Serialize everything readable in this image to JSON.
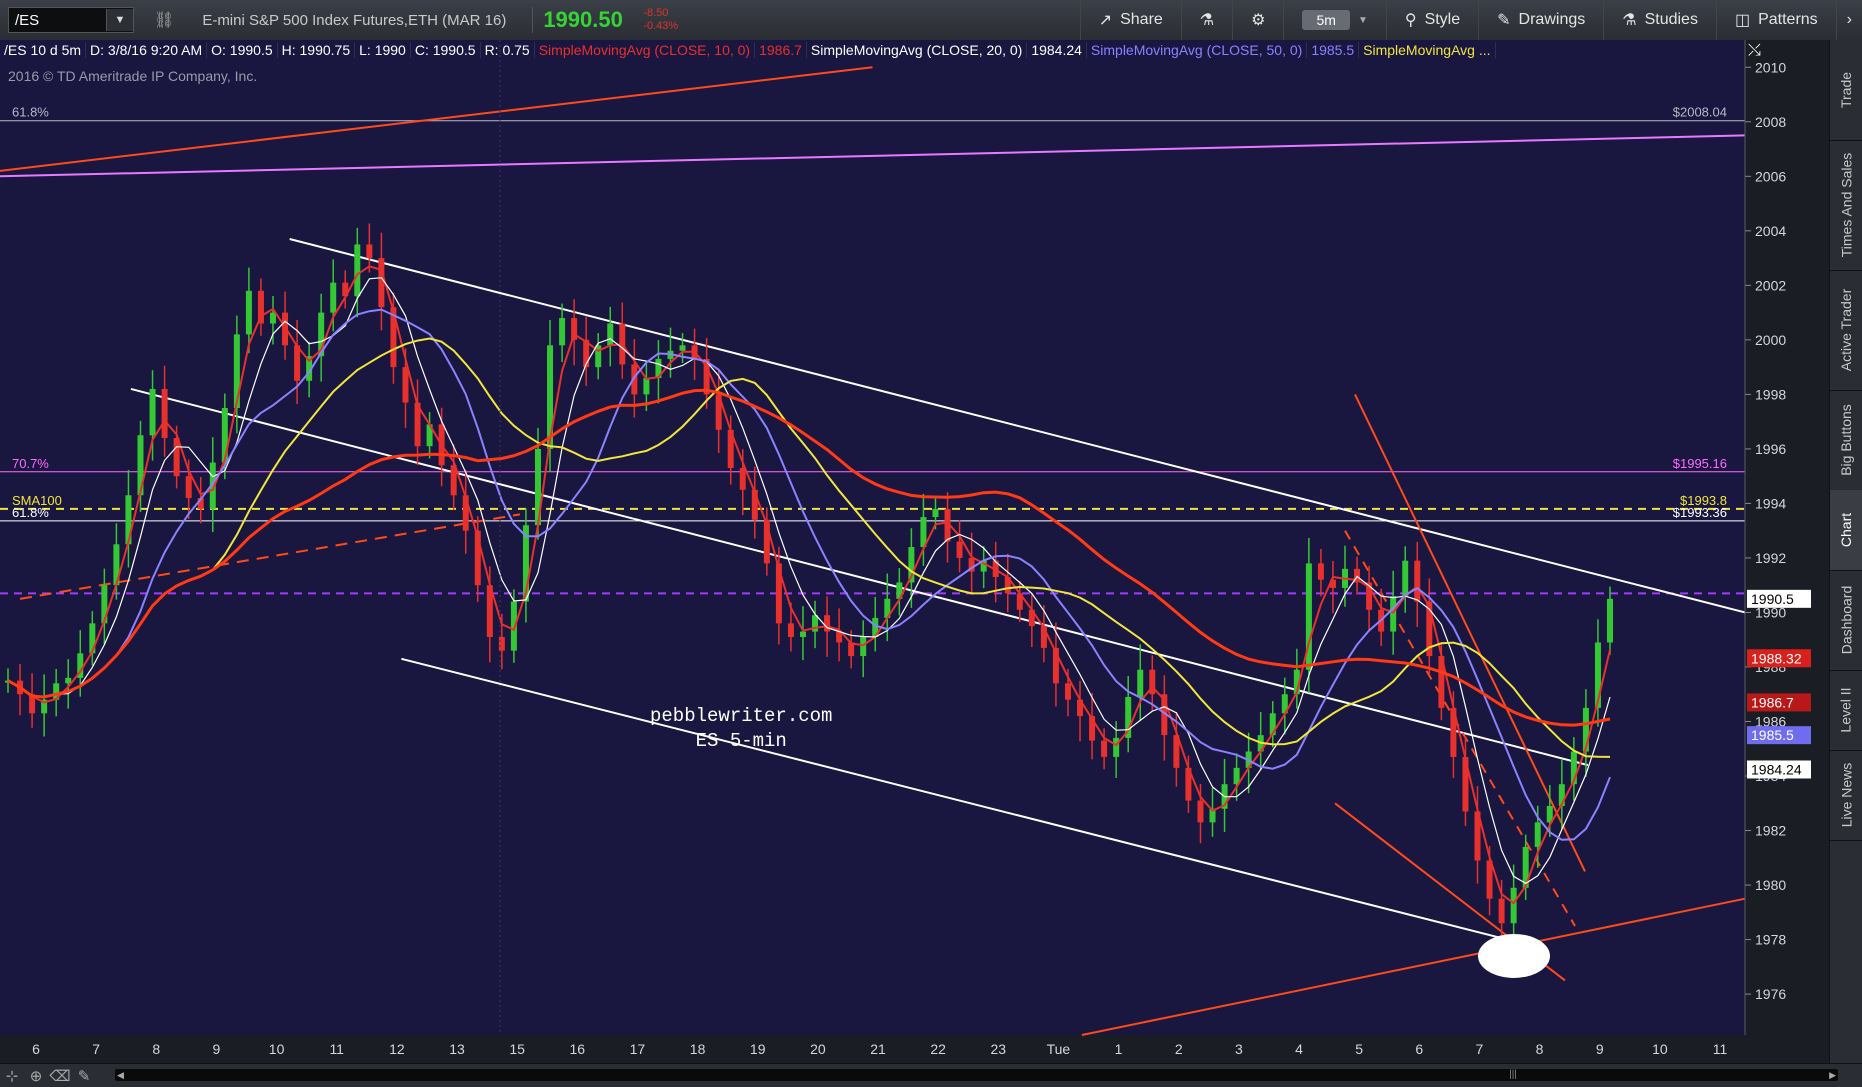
{
  "toolbar": {
    "symbol": "/ES",
    "description": "E-mini S&P 500 Index Futures,ETH (MAR 16)",
    "last_price": "1990.50",
    "change": "-8.50",
    "change_pct": "-0.43%",
    "share_label": "Share",
    "timeframe": "5m",
    "style_label": "Style",
    "drawings_label": "Drawings",
    "studies_label": "Studies",
    "patterns_label": "Patterns"
  },
  "header": {
    "cells": [
      {
        "text": "/ES 10 d 5m",
        "color": "#ffffff"
      },
      {
        "text": "D: 3/8/16 9:20 AM",
        "color": "#ffffff"
      },
      {
        "text": "O: 1990.5",
        "color": "#ffffff"
      },
      {
        "text": "H: 1990.75",
        "color": "#ffffff"
      },
      {
        "text": "L: 1990",
        "color": "#ffffff"
      },
      {
        "text": "C: 1990.5",
        "color": "#ffffff"
      },
      {
        "text": "R: 0.75",
        "color": "#ffffff"
      },
      {
        "text": "SimpleMovingAvg (CLOSE, 10, 0)",
        "color": "#e8312c"
      },
      {
        "text": "1986.7",
        "color": "#e8312c"
      },
      {
        "text": "SimpleMovingAvg (CLOSE, 20, 0)",
        "color": "#ffffff"
      },
      {
        "text": "1984.24",
        "color": "#ffffff"
      },
      {
        "text": "SimpleMovingAvg (CLOSE, 50, 0)",
        "color": "#8a83ff"
      },
      {
        "text": "1985.5",
        "color": "#8a83ff"
      },
      {
        "text": "SimpleMovingAvg ...",
        "color": "#f0e63c"
      }
    ]
  },
  "copyright": "2016 © TD Ameritrade IP Company, Inc.",
  "watermark": {
    "line1": "pebblewriter.com",
    "line2": "ES 5-min"
  },
  "side_tabs": [
    "Trade",
    "Times And Sales",
    "Active Trader",
    "Big Buttons",
    "Chart",
    "Dashboard",
    "Level II",
    "Live News"
  ],
  "active_side_tab": "Chart",
  "chart_data": {
    "type": "candlestick",
    "symbol": "/ES",
    "interval": "5m",
    "ylim": [
      1974.5,
      2011
    ],
    "y_ticks": [
      1976,
      1978,
      1980,
      1982,
      1984,
      1986,
      1988,
      1990,
      1992,
      1994,
      1996,
      1998,
      2000,
      2002,
      2004,
      2006,
      2008,
      2010
    ],
    "x_ticks": [
      "6",
      "7",
      "8",
      "9",
      "10",
      "11",
      "12",
      "13",
      "15",
      "16",
      "17",
      "18",
      "19",
      "20",
      "21",
      "22",
      "23",
      "Tue",
      "1",
      "2",
      "3",
      "4",
      "5",
      "6",
      "7",
      "8",
      "9",
      "10",
      "11"
    ],
    "price_labels": [
      {
        "text": "1990.5",
        "value": 1990.5,
        "bg": "#ffffff",
        "fg": "#000000"
      },
      {
        "text": "1988.32",
        "value": 1988.32,
        "bg": "#d8201c",
        "fg": "#ffffff"
      },
      {
        "text": "1986.7",
        "value": 1986.7,
        "bg": "#b81818",
        "fg": "#ffffff"
      },
      {
        "text": "1985.5",
        "value": 1985.5,
        "bg": "#6f6cf0",
        "fg": "#ffffff"
      },
      {
        "text": "1984.24",
        "value": 1984.24,
        "bg": "#ffffff",
        "fg": "#000000"
      }
    ],
    "levels": [
      {
        "value": 2008.04,
        "left_label": "61.8%",
        "right_label": "$2008.04",
        "color": "#b8b8c8",
        "style": "solid"
      },
      {
        "value": 1995.16,
        "left_label": "70.7%",
        "right_label": "$1995.16",
        "color": "#ff6cff",
        "style": "solid"
      },
      {
        "value": 1993.8,
        "left_label": "SMA100",
        "right_label": "$1993.8",
        "color": "#f0e63c",
        "style": "dashed"
      },
      {
        "value": 1993.36,
        "left_label": "61.8%",
        "right_label": "$1993.36",
        "color": "#ffffff",
        "style": "solid"
      },
      {
        "value": 1990.7,
        "left_label": "",
        "right_label": "",
        "color": "#a23cff",
        "style": "dashed"
      }
    ],
    "series": [
      {
        "name": "SMA 10",
        "color": "#e8312c"
      },
      {
        "name": "SMA 20",
        "color": "#ffffff"
      },
      {
        "name": "SMA 50",
        "color": "#8a83ff"
      },
      {
        "name": "SMA 100",
        "color": "#f0e63c"
      }
    ],
    "candles": [
      1987.5,
      1987.0,
      1986.3,
      1986.8,
      1987.4,
      1987.6,
      1988.5,
      1989.6,
      1991.0,
      1992.5,
      1994.3,
      1996.5,
      1998.2,
      1996.4,
      1995.0,
      1994.2,
      1993.8,
      1995.5,
      1997.5,
      2000.2,
      2001.8,
      2000.6,
      2001.0,
      1999.8,
      1998.5,
      1999.4,
      2001.0,
      2002.1,
      2001.6,
      2003.5,
      2003.0,
      2001.2,
      1999.0,
      1997.7,
      1996.1,
      1996.9,
      1995.4,
      1994.3,
      1993.0,
      1991.0,
      1989.1,
      1988.6,
      1990.4,
      1993.2,
      1996.0,
      1999.8,
      2000.8,
      2000.0,
      1999.0,
      1999.8,
      2000.6,
      1999.1,
      1998.0,
      1998.6,
      1999.3,
      1999.6,
      1999.8,
      1999.3,
      1998.0,
      1996.7,
      1995.3,
      1994.5,
      1993.4,
      1991.8,
      1989.6,
      1989.1,
      1989.3,
      1989.9,
      1989.3,
      1988.9,
      1988.4,
      1989.1,
      1989.8,
      1990.5,
      1991.1,
      1992.4,
      1993.5,
      1993.8,
      1992.6,
      1992.0,
      1991.5,
      1991.9,
      1991.3,
      1990.7,
      1990.1,
      1989.5,
      1988.7,
      1987.4,
      1986.8,
      1986.2,
      1985.3,
      1984.7,
      1985.4,
      1986.9,
      1987.9,
      1987.0,
      1985.5,
      1984.3,
      1983.1,
      1982.3,
      1982.8,
      1983.7,
      1984.3,
      1984.9,
      1985.5,
      1986.3,
      1987.0,
      1987.9,
      1991.8,
      1991.2,
      1990.9,
      1991.6,
      1991.1,
      1990.1,
      1989.3,
      1990.6,
      1991.9,
      1990.4,
      1988.4,
      1986.5,
      1984.7,
      1982.7,
      1980.9,
      1979.5,
      1978.6,
      1979.9,
      1981.4,
      1982.3,
      1982.9,
      1983.7,
      1984.9,
      1986.5,
      1988.9,
      1990.5
    ],
    "trendlines": [
      {
        "x1": 0,
        "y1": 2006.0,
        "x2": 1,
        "y2": 2007.5,
        "color": "#e87aff",
        "width": 2
      },
      {
        "x1": 0,
        "y1": 2006.2,
        "x2": 0.5,
        "y2": 2010.0,
        "color": "#ff4a1a",
        "width": 2
      },
      {
        "x1": 0.166,
        "y1": 2003.7,
        "x2": 1,
        "y2": 1990.0,
        "color": "#ffffff",
        "width": 2
      },
      {
        "x1": 0.075,
        "y1": 1998.2,
        "x2": 0.91,
        "y2": 1984.4,
        "color": "#ffffff",
        "width": 2
      },
      {
        "x1": 0.23,
        "y1": 1988.3,
        "x2": 0.87,
        "y2": 1977.9,
        "color": "#ffffff",
        "width": 2
      },
      {
        "x1": 0.62,
        "y1": 1974.5,
        "x2": 1,
        "y2": 1979.5,
        "color": "#ff4a1a",
        "width": 2
      }
    ]
  }
}
